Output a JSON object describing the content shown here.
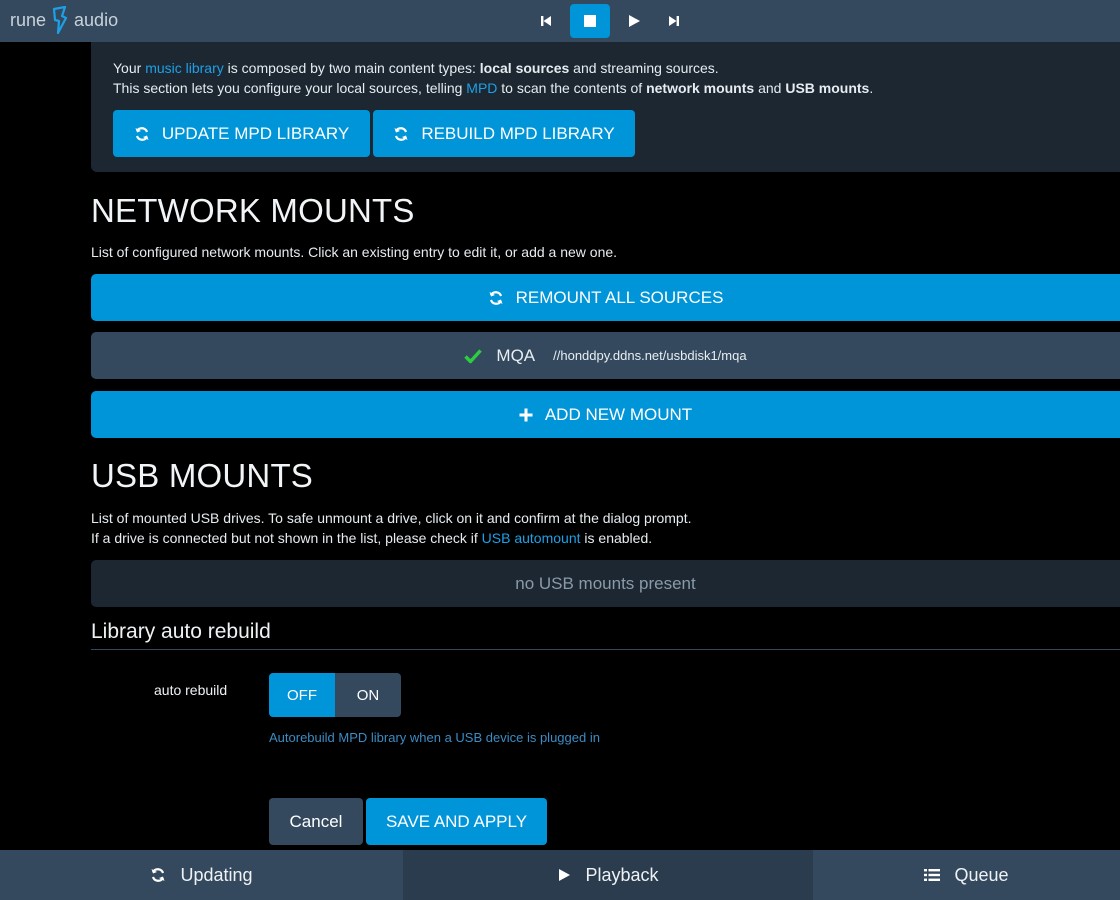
{
  "header": {
    "logo_left": "rune",
    "logo_right": "audio",
    "transport": [
      "previous-icon",
      "stop-icon",
      "play-icon",
      "next-icon"
    ],
    "active_transport": "stop-icon"
  },
  "intro": {
    "line1_a": "Your ",
    "line1_link": "music library",
    "line1_b": " is composed by two main content types: ",
    "line1_bold": "local sources",
    "line1_c": " and streaming sources.",
    "line2_a": "This section lets you configure your local sources, telling ",
    "line2_link": "MPD",
    "line2_b": " to scan the contents of ",
    "line2_bold1": "network mounts",
    "line2_c": " and ",
    "line2_bold2": "USB mounts",
    "line2_d": ".",
    "update_button": "UPDATE MPD LIBRARY",
    "rebuild_button": "REBUILD MPD LIBRARY"
  },
  "network": {
    "title": "NETWORK MOUNTS",
    "description": "List of configured network mounts. Click an existing entry to edit it, or add a new one.",
    "remount_button": "REMOUNT ALL SOURCES",
    "mounts": [
      {
        "name": "MQA",
        "path": "//honddpy.ddns.net/usbdisk1/mqa",
        "status": "ok"
      }
    ],
    "add_button": "ADD NEW MOUNT"
  },
  "usb": {
    "title": "USB MOUNTS",
    "description1": "List of mounted USB drives. To safe unmount a drive, click on it and confirm at the dialog prompt.",
    "description2_a": "If a drive is connected but not shown in the list, please check if ",
    "description2_link": "USB automount",
    "description2_b": " is enabled.",
    "empty_text": "no USB mounts present"
  },
  "autorebuild": {
    "title": "Library auto rebuild",
    "label": "auto rebuild",
    "off": "OFF",
    "on": "ON",
    "selected": "OFF",
    "help": "Autorebuild MPD library when a USB device is plugged in"
  },
  "actions": {
    "cancel": "Cancel",
    "save": "SAVE AND APPLY"
  },
  "footer": {
    "items": [
      {
        "label": "Updating",
        "icon": "refresh-icon"
      },
      {
        "label": "Playback",
        "icon": "play-icon"
      },
      {
        "label": "Queue",
        "icon": "list-icon"
      }
    ],
    "active": "Playback"
  },
  "colors": {
    "accent": "#0095d8",
    "panel": "#34495e",
    "dark_panel": "#1c2732",
    "ok_green": "#2ecc40",
    "link": "#1ea0e6"
  }
}
